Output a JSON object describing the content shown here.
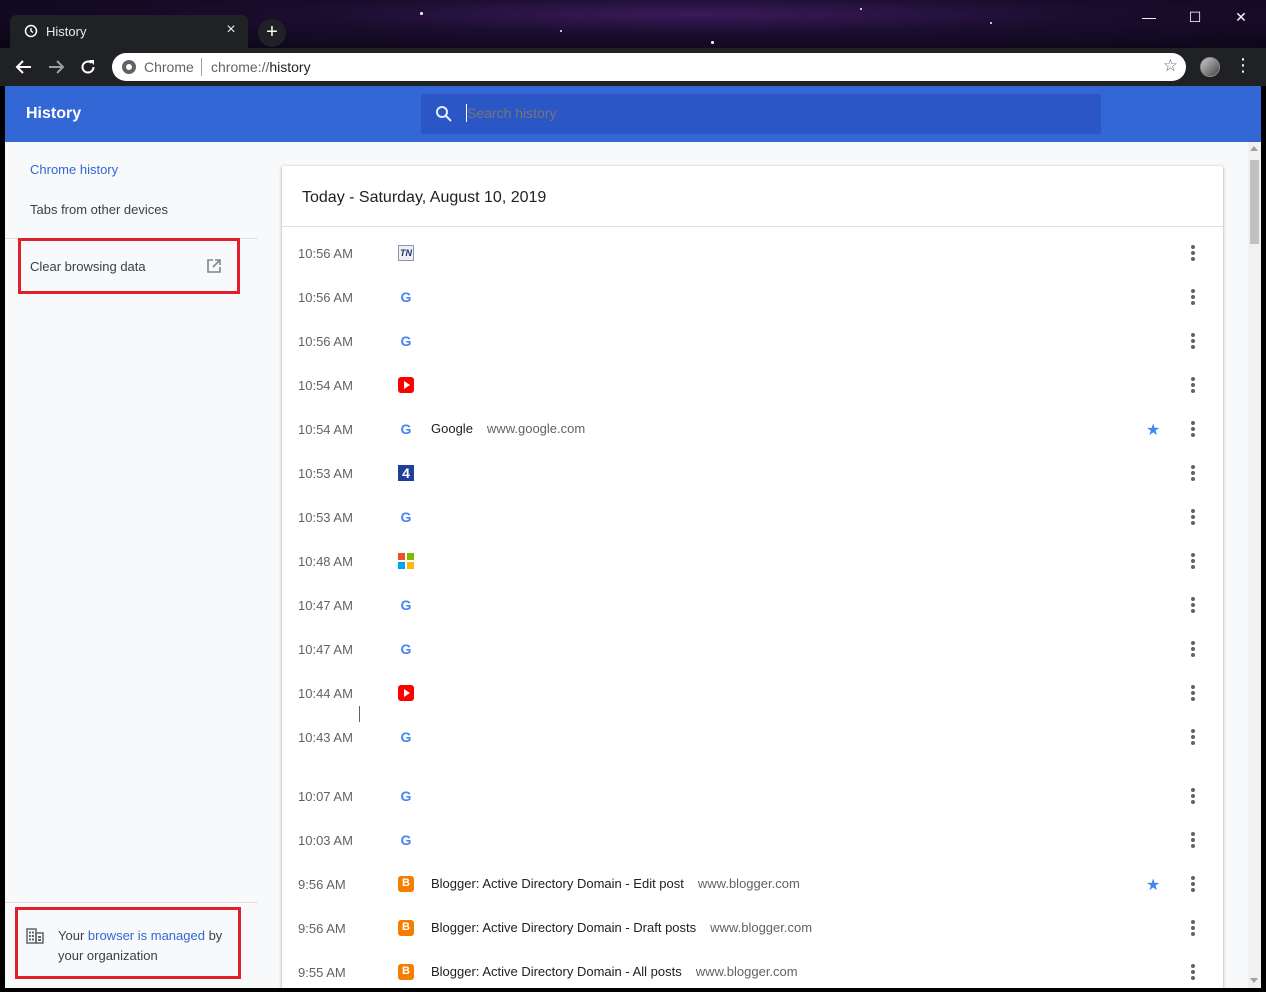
{
  "window": {
    "tab_title": "History",
    "tab_close": "×",
    "new_tab": "+",
    "minimize": "—",
    "maximize": "☐",
    "close": "✕"
  },
  "omnibox": {
    "chip": "Chrome",
    "url_prefix": "chrome://",
    "url_host": "history"
  },
  "header": {
    "title": "History",
    "search_placeholder": "Search history"
  },
  "sidebar": {
    "chrome_history": "Chrome history",
    "tabs_other_devices": "Tabs from other devices",
    "clear_browsing_data": "Clear browsing data",
    "managed_prefix": "Your ",
    "managed_link": "browser is managed",
    "managed_suffix": " by your organization"
  },
  "history": {
    "date_heading": "Today - Saturday, August 10, 2019",
    "rows": [
      {
        "time": "10:56 AM",
        "favicon": "tn-icon",
        "title": "",
        "domain": "",
        "starred": false
      },
      {
        "time": "10:56 AM",
        "favicon": "google-icon",
        "title": "",
        "domain": "",
        "starred": false
      },
      {
        "time": "10:56 AM",
        "favicon": "google-icon",
        "title": "",
        "domain": "",
        "starred": false
      },
      {
        "time": "10:54 AM",
        "favicon": "youtube-icon",
        "title": "",
        "domain": "",
        "starred": false
      },
      {
        "time": "10:54 AM",
        "favicon": "google-icon",
        "title": "Google",
        "domain": "www.google.com",
        "starred": true
      },
      {
        "time": "10:53 AM",
        "favicon": "channel4-icon",
        "title": "",
        "domain": "",
        "starred": false
      },
      {
        "time": "10:53 AM",
        "favicon": "google-icon",
        "title": "",
        "domain": "",
        "starred": false
      },
      {
        "time": "10:48 AM",
        "favicon": "microsoft-icon",
        "title": "",
        "domain": "",
        "starred": false
      },
      {
        "time": "10:47 AM",
        "favicon": "google-icon",
        "title": "",
        "domain": "",
        "starred": false
      },
      {
        "time": "10:47 AM",
        "favicon": "google-icon",
        "title": "",
        "domain": "",
        "starred": false
      },
      {
        "time": "10:44 AM",
        "favicon": "youtube-icon",
        "title": "",
        "domain": "",
        "starred": false
      },
      {
        "time": "10:43 AM",
        "favicon": "google-icon",
        "title": "",
        "domain": "",
        "starred": false
      },
      {
        "time": "10:07 AM",
        "favicon": "google-icon",
        "title": "",
        "domain": "",
        "starred": false
      },
      {
        "time": "10:03 AM",
        "favicon": "google-icon",
        "title": "",
        "domain": "",
        "starred": false
      },
      {
        "time": "9:56 AM",
        "favicon": "blogger-icon",
        "title": "Blogger: Active Directory Domain - Edit post",
        "domain": "www.blogger.com",
        "starred": true
      },
      {
        "time": "9:56 AM",
        "favicon": "blogger-icon",
        "title": "Blogger: Active Directory Domain - Draft posts",
        "domain": "www.blogger.com",
        "starred": false
      },
      {
        "time": "9:55 AM",
        "favicon": "blogger-icon",
        "title": "Blogger: Active Directory Domain - All posts",
        "domain": "www.blogger.com",
        "starred": false
      }
    ]
  },
  "colors": {
    "header_blue": "#3367d6",
    "link_blue": "#3367d6",
    "highlight_red": "#e0202a"
  }
}
